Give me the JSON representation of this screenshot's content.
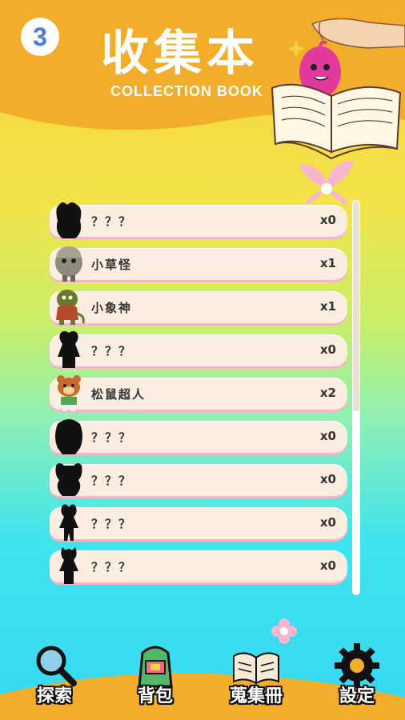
{
  "header": {
    "level": "3",
    "title": "收集本",
    "subtitle": "COLLECTION BOOK"
  },
  "collection": {
    "items": [
      {
        "name": "？？？",
        "count": "x0",
        "known": false
      },
      {
        "name": "小草怪",
        "count": "x1",
        "known": true,
        "color": "#8f8a7e"
      },
      {
        "name": "小象神",
        "count": "x1",
        "known": true,
        "color": "#6a7a2a"
      },
      {
        "name": "？？？",
        "count": "x0",
        "known": false
      },
      {
        "name": "松鼠超人",
        "count": "x2",
        "known": true,
        "color": "#c86a2a"
      },
      {
        "name": "？？？",
        "count": "x0",
        "known": false
      },
      {
        "name": "？？？",
        "count": "x0",
        "known": false
      },
      {
        "name": "？？？",
        "count": "x0",
        "known": false
      },
      {
        "name": "？？？",
        "count": "x0",
        "known": false
      }
    ]
  },
  "nav": {
    "explore": "探索",
    "backpack": "背包",
    "collection": "蒐集冊",
    "settings": "設定"
  },
  "icons": {
    "explore": "magnifier-icon",
    "backpack": "backpack-icon",
    "collection": "open-book-icon",
    "settings": "gear-icon"
  },
  "colors": {
    "header": "#f2ad2a",
    "card": "#fbeee0",
    "card_shadow": "#f2b6c8",
    "badge_text": "#4a7bd8"
  }
}
